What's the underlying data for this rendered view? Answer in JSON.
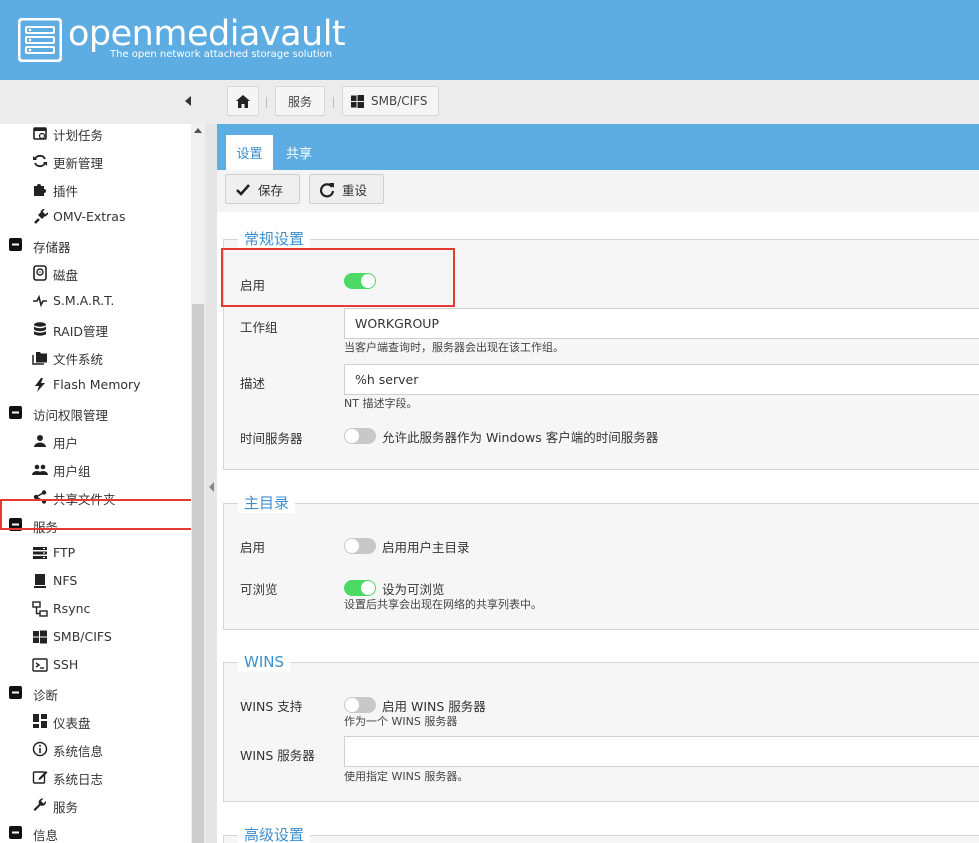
{
  "header": {
    "brand": "openmediavault",
    "tagline": "The open network attached storage solution"
  },
  "breadcrumb": {
    "home_icon": "home-icon",
    "services": "服务",
    "current": "SMB/CIFS"
  },
  "sidebar": {
    "items": [
      {
        "label": "计划任务",
        "icon": "calendar-icon",
        "group": false
      },
      {
        "label": "更新管理",
        "icon": "refresh-icon",
        "group": false
      },
      {
        "label": "插件",
        "icon": "puzzle-icon",
        "group": false
      },
      {
        "label": "OMV-Extras",
        "icon": "plug-icon",
        "group": false
      },
      {
        "label": "存储器",
        "icon": "minus-square-icon",
        "group": true
      },
      {
        "label": "磁盘",
        "icon": "disk-icon",
        "group": false
      },
      {
        "label": "S.M.A.R.T.",
        "icon": "pulse-icon",
        "group": false
      },
      {
        "label": "RAID管理",
        "icon": "database-icon",
        "group": false
      },
      {
        "label": "文件系统",
        "icon": "folders-icon",
        "group": false
      },
      {
        "label": "Flash Memory",
        "icon": "flash-icon",
        "group": false
      },
      {
        "label": "访问权限管理",
        "icon": "minus-square-icon",
        "group": true
      },
      {
        "label": "用户",
        "icon": "user-icon",
        "group": false
      },
      {
        "label": "用户组",
        "icon": "users-icon",
        "group": false
      },
      {
        "label": "共享文件夹",
        "icon": "share-icon",
        "group": false
      },
      {
        "label": "服务",
        "icon": "minus-square-icon",
        "group": true
      },
      {
        "label": "FTP",
        "icon": "server-icon",
        "group": false
      },
      {
        "label": "NFS",
        "icon": "monitor-icon",
        "group": false
      },
      {
        "label": "Rsync",
        "icon": "network-icon",
        "group": false
      },
      {
        "label": "SMB/CIFS",
        "icon": "windows-icon",
        "group": false
      },
      {
        "label": "SSH",
        "icon": "terminal-icon",
        "group": false
      },
      {
        "label": "诊断",
        "icon": "minus-square-icon",
        "group": true
      },
      {
        "label": "仪表盘",
        "icon": "dashboard-icon",
        "group": false
      },
      {
        "label": "系统信息",
        "icon": "info-icon",
        "group": false
      },
      {
        "label": "系统日志",
        "icon": "edit-icon",
        "group": false
      },
      {
        "label": "服务",
        "icon": "wrench-icon",
        "group": false
      },
      {
        "label": "信息",
        "icon": "minus-square-icon",
        "group": true
      }
    ]
  },
  "tabs": [
    {
      "label": "设置",
      "active": true
    },
    {
      "label": "共享",
      "active": false
    }
  ],
  "toolbar": {
    "save_label": "保存",
    "reset_label": "重设"
  },
  "general": {
    "legend": "常规设置",
    "enable_label": "启用",
    "enable_on": true,
    "workgroup_label": "工作组",
    "workgroup_value": "WORKGROUP",
    "workgroup_hint": "当客户端查询时，服务器会出现在该工作组。",
    "description_label": "描述",
    "description_value": "%h server",
    "description_hint": "NT 描述字段。",
    "timeserver_label": "时间服务器",
    "timeserver_on": false,
    "timeserver_text": "允许此服务器作为 Windows 客户端的时间服务器"
  },
  "homes": {
    "legend": "主目录",
    "enable_label": "启用",
    "enable_on": false,
    "enable_text": "启用用户主目录",
    "browsable_label": "可浏览",
    "browsable_on": true,
    "browsable_text": "设为可浏览",
    "browsable_hint": "设置后共享会出现在网络的共享列表中。"
  },
  "wins": {
    "legend": "WINS",
    "support_label": "WINS 支持",
    "support_on": false,
    "support_text": "启用 WINS 服务器",
    "support_hint": "作为一个 WINS 服务器",
    "server_label": "WINS 服务器",
    "server_value": "",
    "server_hint": "使用指定 WINS 服务器。"
  },
  "advanced": {
    "legend": "高级设置"
  },
  "colors": {
    "header": "#5dade2",
    "accent": "#3c8fd0",
    "toggle_on": "#4cd964",
    "toggle_off": "#c8c8c8",
    "highlight": "#e53935"
  }
}
